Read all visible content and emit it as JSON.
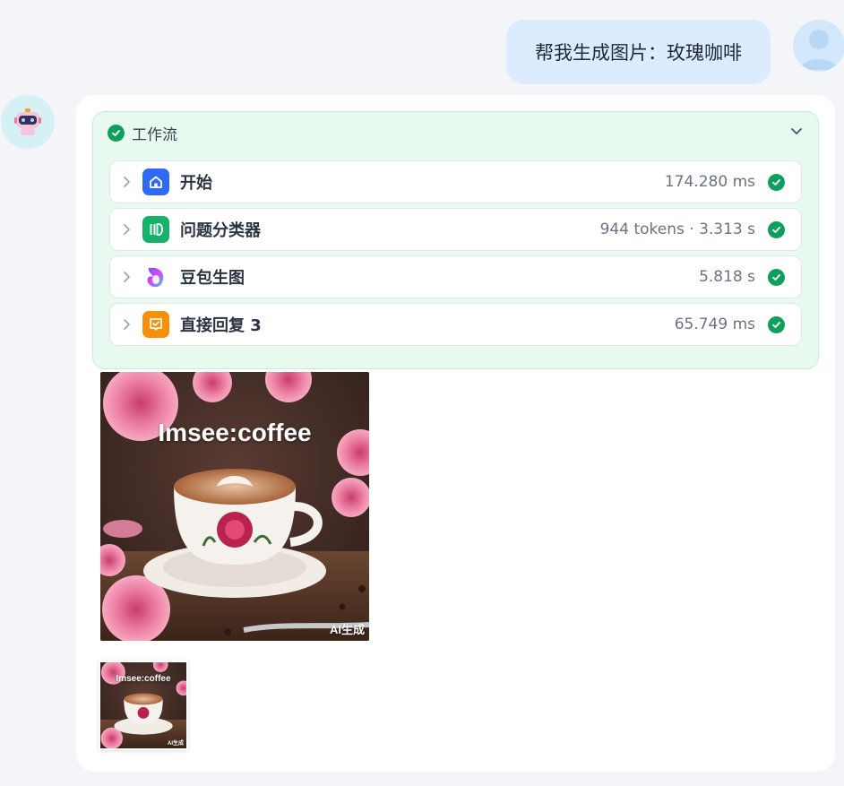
{
  "user_message": {
    "text": "帮我生成图片：玫瑰咖啡"
  },
  "workflow": {
    "title": "工作流",
    "steps": [
      {
        "label": "开始",
        "time": "174.280 ms",
        "icon": "home-icon",
        "color": "#2f6bf2"
      },
      {
        "label": "问题分类器",
        "time": "944 tokens · 3.313 s",
        "icon": "classifier-icon",
        "color": "#17b26a"
      },
      {
        "label": "豆包生图",
        "time": "5.818 s",
        "icon": "doubao-icon",
        "color": "#7b4dff"
      },
      {
        "label": "直接回复 3",
        "time": "65.749 ms",
        "icon": "reply-icon",
        "color": "#f79009"
      }
    ]
  },
  "generated_image": {
    "brand_text": "Imsee:coffee",
    "badge": "AI生成"
  },
  "colors": {
    "success": "#0e9f5f",
    "workflow_bg": "#e8faf0",
    "user_bubble": "#dcebfd"
  }
}
